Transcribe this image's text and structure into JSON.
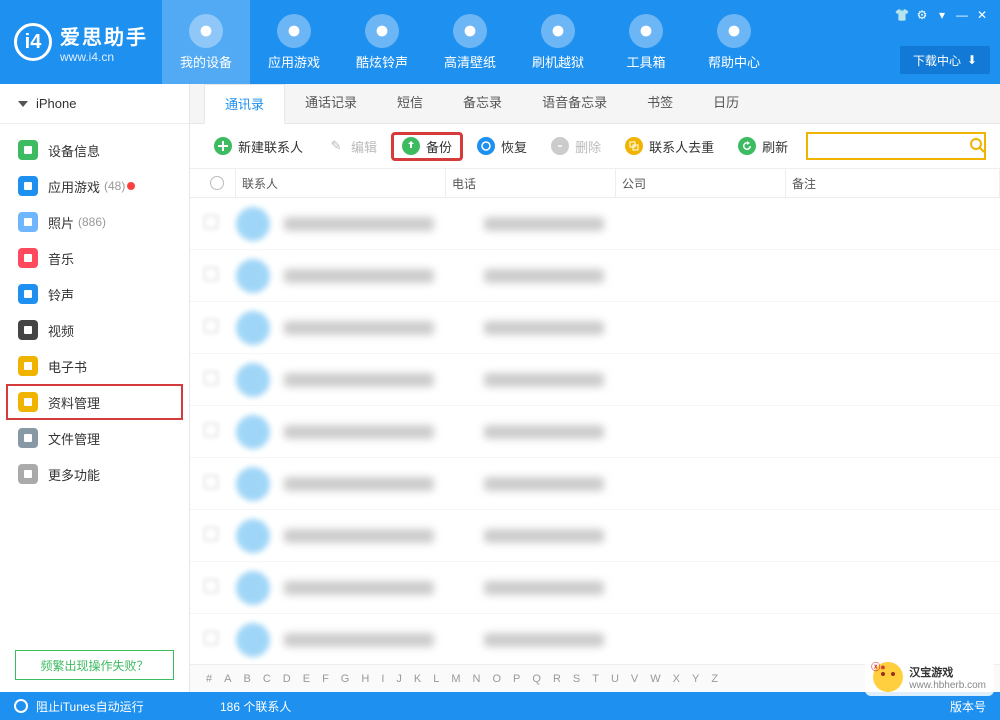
{
  "header": {
    "brand_cn": "爱思助手",
    "brand_en": "www.i4.cn",
    "download_center": "下载中心",
    "nav": [
      {
        "label": "我的设备",
        "icon": "apple"
      },
      {
        "label": "应用游戏",
        "icon": "app"
      },
      {
        "label": "酷炫铃声",
        "icon": "bell"
      },
      {
        "label": "高清壁纸",
        "icon": "wallpaper"
      },
      {
        "label": "刷机越狱",
        "icon": "box"
      },
      {
        "label": "工具箱",
        "icon": "wrench"
      },
      {
        "label": "帮助中心",
        "icon": "info"
      }
    ]
  },
  "sidebar": {
    "device": "iPhone",
    "items": [
      {
        "label": "设备信息",
        "count": "",
        "color": "#3dbb61"
      },
      {
        "label": "应用游戏",
        "count": "(48)",
        "color": "#1e90f0",
        "dot": true
      },
      {
        "label": "照片",
        "count": "(886)",
        "color": "#6fb6ff"
      },
      {
        "label": "音乐",
        "count": "",
        "color": "#ff4a5e"
      },
      {
        "label": "铃声",
        "count": "",
        "color": "#1e90f0"
      },
      {
        "label": "视频",
        "count": "",
        "color": "#444"
      },
      {
        "label": "电子书",
        "count": "",
        "color": "#f0b400"
      },
      {
        "label": "资料管理",
        "count": "",
        "color": "#f0b400",
        "selected": true
      },
      {
        "label": "文件管理",
        "count": "",
        "color": "#8899a6"
      },
      {
        "label": "更多功能",
        "count": "",
        "color": "#aaa"
      }
    ],
    "faq": "频繁出现操作失败？"
  },
  "tabs": [
    "通讯录",
    "通话记录",
    "短信",
    "备忘录",
    "语音备忘录",
    "书签",
    "日历"
  ],
  "active_tab": 0,
  "toolbar": {
    "new_contact": "新建联系人",
    "edit": "编辑",
    "backup": "备份",
    "restore": "恢复",
    "delete": "删除",
    "dedupe": "联系人去重",
    "refresh": "刷新",
    "search_placeholder": ""
  },
  "table": {
    "headers": {
      "contact": "联系人",
      "phone": "电话",
      "company": "公司",
      "remark": "备注"
    },
    "row_count": 9
  },
  "alpha_index": [
    "#",
    "A",
    "B",
    "C",
    "D",
    "E",
    "F",
    "G",
    "H",
    "I",
    "J",
    "K",
    "L",
    "M",
    "N",
    "O",
    "P",
    "Q",
    "R",
    "S",
    "T",
    "U",
    "V",
    "W",
    "X",
    "Y",
    "Z"
  ],
  "status": {
    "left": "阻止iTunes自动运行",
    "mid": "186 个联系人",
    "right": "版本号"
  },
  "watermark": {
    "line1": "汉宝游戏",
    "line2": "www.hbherb.com"
  }
}
